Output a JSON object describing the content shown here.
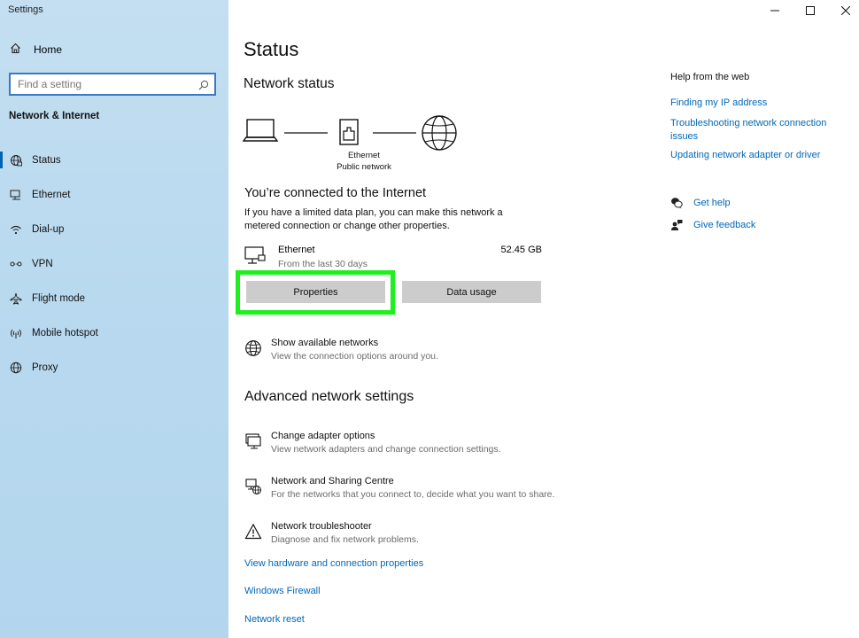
{
  "window": {
    "title": "Settings",
    "controls": [
      "minimize",
      "maximize",
      "close"
    ]
  },
  "sidebar": {
    "home_label": "Home",
    "search_placeholder": "Find a setting",
    "section_label": "Network & Internet",
    "items": [
      {
        "label": "Status",
        "icon": "globe-network-icon",
        "active": true
      },
      {
        "label": "Ethernet",
        "icon": "ethernet-icon",
        "active": false
      },
      {
        "label": "Dial-up",
        "icon": "dial-up-icon",
        "active": false
      },
      {
        "label": "VPN",
        "icon": "vpn-icon",
        "active": false
      },
      {
        "label": "Flight mode",
        "icon": "airplane-icon",
        "active": false
      },
      {
        "label": "Mobile hotspot",
        "icon": "hotspot-icon",
        "active": false
      },
      {
        "label": "Proxy",
        "icon": "globe-icon",
        "active": false
      }
    ]
  },
  "main": {
    "title": "Status",
    "network_status_heading": "Network status",
    "diagram": {
      "adapter_label": "Ethernet",
      "network_label": "Public network"
    },
    "connected_title": "You’re connected to the Internet",
    "connected_desc": "If you have a limited data plan, you can make this network a metered connection or change other properties.",
    "ethernet": {
      "name": "Ethernet",
      "period": "From the last 30 days",
      "usage": "52.45 GB"
    },
    "buttons": {
      "properties": "Properties",
      "data_usage": "Data usage"
    },
    "show_networks": {
      "title": "Show available networks",
      "desc": "View the connection options around you."
    },
    "advanced_heading": "Advanced network settings",
    "advanced_options": [
      {
        "title": "Change adapter options",
        "desc": "View network adapters and change connection settings."
      },
      {
        "title": "Network and Sharing Centre",
        "desc": "For the networks that you connect to, decide what you want to share."
      },
      {
        "title": "Network troubleshooter",
        "desc": "Diagnose and fix network problems."
      }
    ],
    "links": [
      "View hardware and connection properties",
      "Windows Firewall",
      "Network reset"
    ]
  },
  "help": {
    "title": "Help from the web",
    "links": [
      "Finding my IP address",
      "Troubleshooting network connection issues",
      "Updating network adapter or driver"
    ],
    "get_help": "Get help",
    "give_feedback": "Give feedback"
  },
  "colors": {
    "accent": "#0067b8",
    "sidebar_bg": "#b9d9ef",
    "button_bg": "#cccccc",
    "highlight": "#1ef01e"
  }
}
